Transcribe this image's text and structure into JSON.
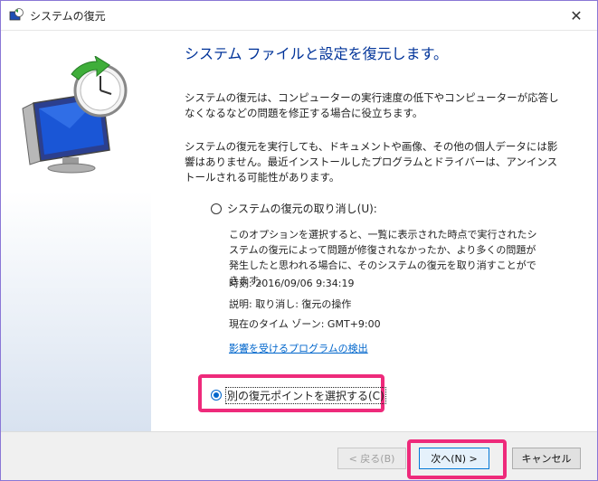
{
  "window": {
    "title": "システムの復元",
    "close_symbol": "✕"
  },
  "main": {
    "heading": "システム ファイルと設定を復元します。",
    "paragraph1": "システムの復元は、コンピューターの実行速度の低下やコンピューターが応答しなくなるなどの問題を修正する場合に役立ちます。",
    "paragraph2": "システムの復元を実行しても、ドキュメントや画像、その他の個人データには影響はありません。最近インストールしたプログラムとドライバーは、アンインストールされる可能性があります。",
    "undo_option": {
      "label": "システムの復元の取り消し(U):",
      "description": "このオプションを選択すると、一覧に表示された時点で実行されたシステムの復元によって問題が修復されなかったか、より多くの問題が発生したと思われる場合に、そのシステムの復元を取り消すことができます。",
      "time": "時刻: 2016/09/06 9:34:19",
      "explanation": "説明: 取り消し: 復元の操作",
      "timezone": "現在のタイム ゾーン: GMT+9:00",
      "scan_link": "影響を受けるプログラムの検出",
      "selected": false
    },
    "other_option": {
      "label": "別の復元ポイントを選択する(C)",
      "selected": true
    }
  },
  "footer": {
    "back_label": "< 戻る(B)",
    "next_label": "次へ(N) >",
    "cancel_label": "キャンセル"
  },
  "colors": {
    "heading": "#003399",
    "link": "#0066cc",
    "highlight": "#ee2a7b",
    "window_border": "#8a77d6"
  }
}
